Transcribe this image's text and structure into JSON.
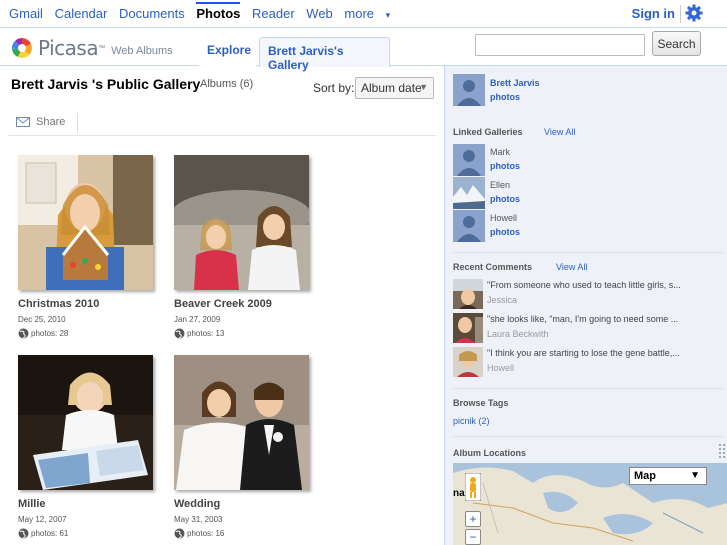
{
  "gbar": {
    "links": [
      "Gmail",
      "Calendar",
      "Documents",
      "Photos",
      "Reader",
      "Web",
      "more"
    ],
    "more_caret": "▾",
    "signin": "Sign in"
  },
  "header": {
    "logo": "Picasa",
    "logo_tm": "™",
    "logo_sub": "Web Albums",
    "tab_explore": "Explore",
    "tab_gallery": "Brett Jarvis's Gallery",
    "search_button": "Search",
    "search_value": ""
  },
  "main": {
    "title": "Brett Jarvis 's Public Gallery",
    "count": "Albums (6)",
    "sort_label": "Sort by:",
    "sort_value": "Album date",
    "share_label": "Share",
    "albums": [
      {
        "name": "Christmas 2010",
        "date": "Dec 25, 2010",
        "photos": "photos: 28"
      },
      {
        "name": "Beaver Creek 2009",
        "date": "Jan 27, 2009",
        "photos": "photos: 13"
      },
      {
        "name": "Millie",
        "date": "May 12, 2007",
        "photos": "photos: 61"
      },
      {
        "name": "Wedding",
        "date": "May 31, 2003",
        "photos": "photos: 16"
      }
    ]
  },
  "sidebar": {
    "owner": {
      "name": "Brett Jarvis",
      "photos": "photos"
    },
    "linked_title": "Linked Galleries",
    "linked_viewall": "View All",
    "linked": [
      {
        "name": "Mark",
        "photos": "photos"
      },
      {
        "name": "Ellen",
        "photos": "photos"
      },
      {
        "name": "Howell",
        "photos": "photos"
      }
    ],
    "comments_title": "Recent Comments",
    "comments_viewall": "View All",
    "comments": [
      {
        "text": "\"From someone who used to teach little girls, s...",
        "author": "Jessica"
      },
      {
        "text": "\"she looks like, \"man, I'm going to need some ...",
        "author": "Laura Beckwith"
      },
      {
        "text": "\"I think you are starting to lose the gene battle,...",
        "author": "Howell"
      }
    ],
    "tags_title": "Browse Tags",
    "tags": [
      "picnik (2)"
    ],
    "map_title": "Album Locations",
    "map_type": "Map",
    "map_caret": "▼",
    "map_label": "na",
    "zoom_in": "+",
    "zoom_out": "−"
  }
}
